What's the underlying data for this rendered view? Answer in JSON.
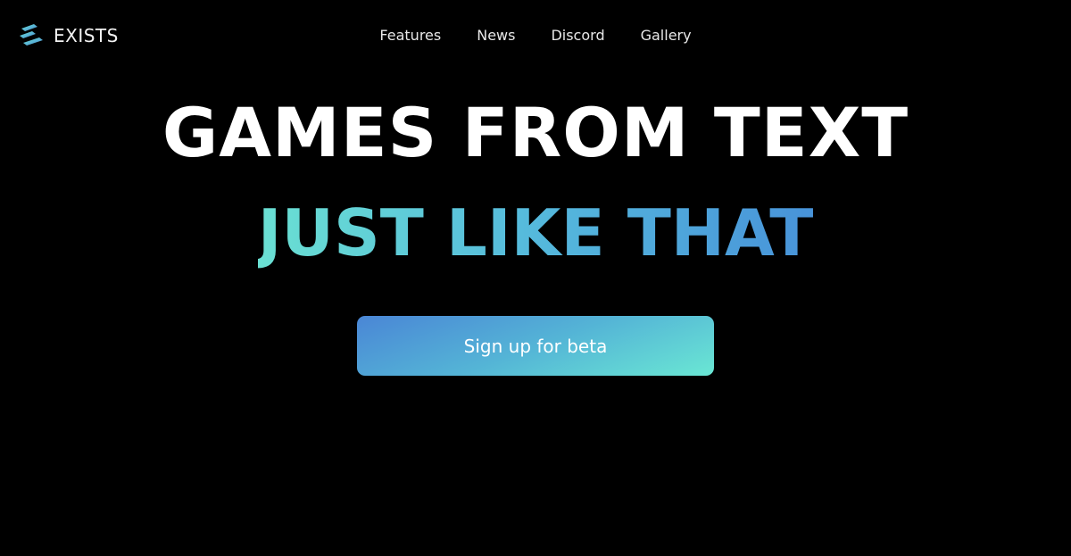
{
  "brand": {
    "name": "EXISTS",
    "logo_icon": "stacked-bars-logo-icon",
    "colors": {
      "teal": "#6ae7d4",
      "blue": "#4a86d6"
    }
  },
  "nav": {
    "items": [
      {
        "label": "Features"
      },
      {
        "label": "News"
      },
      {
        "label": "Discord"
      },
      {
        "label": "Gallery"
      }
    ]
  },
  "hero": {
    "headline": "GAMES FROM TEXT",
    "subheadline": "JUST LIKE THAT",
    "cta_label": "Sign up for beta"
  }
}
